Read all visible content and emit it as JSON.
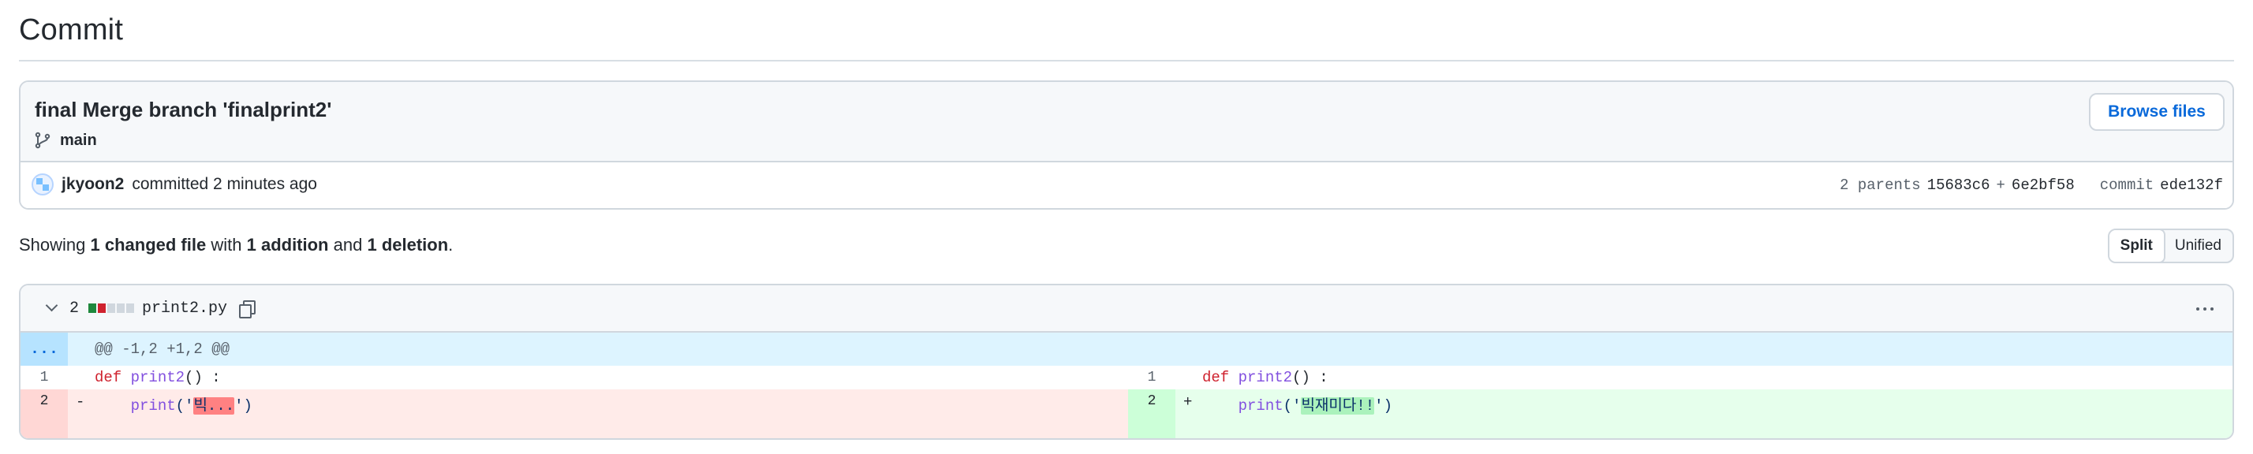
{
  "page_title": "Commit",
  "commit": {
    "message": "final Merge branch 'finalprint2'",
    "branch": "main",
    "browse_label": "Browse files",
    "author": "jkyoon2",
    "time_text": "committed 2 minutes ago",
    "parents_label": "2 parents",
    "parent1": "15683c6",
    "plus": "+",
    "parent2": "6e2bf58",
    "commit_label": "commit",
    "commit_hash": "ede132f"
  },
  "summary": {
    "showing": "Showing",
    "changed": "1 changed file",
    "with": "with",
    "additions": "1 addition",
    "and": "and",
    "deletions": "1 deletion",
    "end": "."
  },
  "view_toggle": {
    "split": "Split",
    "unified": "Unified",
    "active": "split"
  },
  "file": {
    "change_count": "2",
    "name": "print2.py",
    "hunk_expand": "...",
    "hunk_header": "@@ -1,2 +1,2 @@",
    "left": [
      {
        "num": "1",
        "sign": "",
        "kw": "def",
        "fn": "print2",
        "rest": "() :"
      },
      {
        "num": "2",
        "sign": "-",
        "indent": "    ",
        "fn": "print",
        "open": "('",
        "word": "빅...",
        "close": "')"
      }
    ],
    "right": [
      {
        "num": "1",
        "sign": "",
        "kw": "def",
        "fn": "print2",
        "rest": "() :"
      },
      {
        "num": "2",
        "sign": "+",
        "indent": "    ",
        "fn": "print",
        "open": "('",
        "word": "빅재미다!!",
        "close": "')"
      }
    ]
  },
  "colors": {
    "deletion_bg": "#ffebe9",
    "addition_bg": "#e6ffec",
    "hunk_bg": "#ddf4ff",
    "link_blue": "#0969da"
  }
}
